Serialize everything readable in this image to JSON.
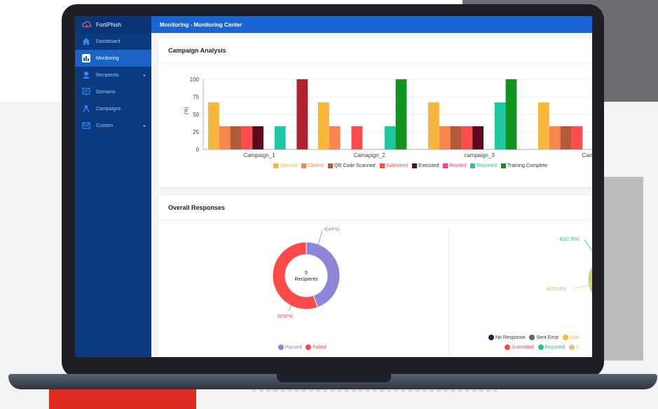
{
  "app": {
    "brand": "FortiPhish"
  },
  "sidebar": {
    "items": [
      {
        "label": "Dashboard",
        "icon": "home-icon",
        "active": false,
        "has_arrow": false
      },
      {
        "label": "Monitoring",
        "icon": "bar-chart-icon",
        "active": true,
        "has_arrow": false
      },
      {
        "label": "Recipients",
        "icon": "user-icon",
        "active": false,
        "has_arrow": true
      },
      {
        "label": "Domains",
        "icon": "domain-icon",
        "active": false,
        "has_arrow": false
      },
      {
        "label": "Campaigns",
        "icon": "campaign-icon",
        "active": false,
        "has_arrow": false
      },
      {
        "label": "Custom",
        "icon": "mail-icon",
        "active": false,
        "has_arrow": true
      }
    ]
  },
  "header": {
    "breadcrumb": "Monitoring - Monitoring Center"
  },
  "campaign_analysis": {
    "title": "Campaign Analysis",
    "chart_data": {
      "type": "bar",
      "ylabel": "(%)",
      "ylim": [
        0,
        100
      ],
      "yticks": [
        "0",
        "25",
        "50",
        "75",
        "100"
      ],
      "categories": [
        "Campaign_1",
        "Camapign_2",
        "campaign_3",
        "Camp"
      ],
      "series": [
        {
          "name": "Opened",
          "color": "#f6b73c",
          "values": [
            67,
            67,
            67,
            67
          ]
        },
        {
          "name": "Clicked",
          "color": "#f7874c",
          "values": [
            33,
            33,
            33,
            33
          ]
        },
        {
          "name": "QR Code Scanned",
          "color": "#b25a3a",
          "values": [
            33,
            0,
            33,
            33
          ]
        },
        {
          "name": "Submitted",
          "color": "#ff4d4d",
          "values": [
            33,
            33,
            33,
            33
          ]
        },
        {
          "name": "Executed",
          "color": "#5c0a1e",
          "values": [
            33,
            0,
            33,
            0
          ]
        },
        {
          "name": "Replied",
          "color": "#ff3a8c",
          "values": [
            0,
            0,
            0,
            0
          ]
        },
        {
          "name": "Reported",
          "color": "#1fc7a0",
          "values": [
            33,
            33,
            67,
            0
          ]
        },
        {
          "name": "Training Complete",
          "color": "#12931f",
          "values": [
            0,
            100,
            100,
            0
          ]
        },
        {
          "name": "",
          "color": "#b2222f",
          "values": [
            100,
            0,
            0,
            0
          ]
        }
      ]
    }
  },
  "overall_responses": {
    "title": "Overall Responses",
    "left_donut": {
      "center_value": "9",
      "center_label": "Recipients",
      "slices": [
        {
          "name": "Passed",
          "value": 4,
          "label": "4(44%)",
          "color": "#8d86d8"
        },
        {
          "name": "Failed",
          "value": 5,
          "label": "5(56%)",
          "color": "#ff4a4a"
        }
      ]
    },
    "right_donut": {
      "labels": [
        "4(12.9%)",
        "9(29.0%)"
      ],
      "legend_row1": [
        {
          "name": "No Response",
          "color": "#0f2d4a"
        },
        {
          "name": "Sent Error",
          "color": "#5c6670"
        },
        {
          "name": "Ope",
          "color": "#f6b73c"
        }
      ],
      "legend_row2": [
        {
          "name": "Submitted",
          "color": "#ff4a4a"
        },
        {
          "name": "Reported",
          "color": "#1fc7a0"
        },
        {
          "name": "C",
          "color": "#d8c98a"
        }
      ]
    }
  }
}
